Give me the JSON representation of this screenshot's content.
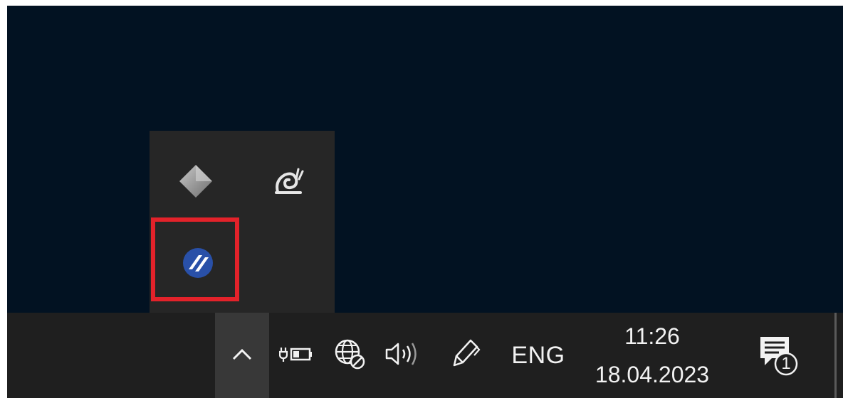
{
  "taskbar": {
    "language": "ENG",
    "time": "11:26",
    "date": "18.04.2023",
    "notification_count": "1"
  },
  "tray_flyout": {
    "icons": [
      "diamond-app-icon",
      "snail-app-icon",
      "blue-stripes-app-icon"
    ],
    "highlighted_icon": "blue-stripes-app-icon",
    "highlight_color": "#e3222a"
  },
  "icons": {
    "show_hidden": "chevron-up-icon",
    "power": "battery-charging-icon",
    "network": "globe-network-icon",
    "volume": "speaker-icon",
    "pen": "pen-icon",
    "notifications": "action-center-icon"
  },
  "colors": {
    "desktop": "#021222",
    "taskbar": "#1f1f1f",
    "flyout": "#262626",
    "accent_blue": "#2950a8"
  }
}
